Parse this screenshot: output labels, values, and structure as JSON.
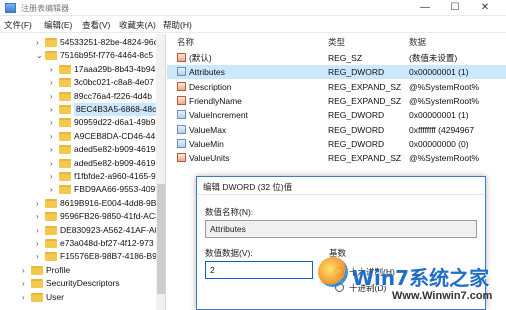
{
  "window": {
    "title": "注册表编辑器",
    "min_glyph": "—",
    "max_glyph": "☐",
    "close_glyph": "✕"
  },
  "menu": [
    "文件(F)",
    "编辑(E)",
    "查看(V)",
    "收藏夹(A)",
    "帮助(H)"
  ],
  "tree": {
    "items": [
      {
        "label": "54533251-82be-4824-96c",
        "expander": "›",
        "indent": 0
      },
      {
        "label": "7516b95f-f776-4464-8c5",
        "expander": "⌄",
        "indent": 0
      },
      {
        "label": "17aaa29b-8b43-4b94",
        "expander": "›",
        "indent": 1
      },
      {
        "label": "3c0bc021-c8a8-4e07",
        "expander": "›",
        "indent": 1
      },
      {
        "label": "89cc76a4-f226-4d4b",
        "expander": "›",
        "indent": 1
      },
      {
        "label": "8EC4B3A5-6868-48c2",
        "expander": "›",
        "indent": 1,
        "selected": true
      },
      {
        "label": "90959d22-d6a1-49b9",
        "expander": "›",
        "indent": 1
      },
      {
        "label": "A9CEB8DA-CD46-44F",
        "expander": "›",
        "indent": 1
      },
      {
        "label": "aded5e82-b909-4619",
        "expander": "›",
        "indent": 1
      },
      {
        "label": "aded5e82-b909-4619",
        "expander": "›",
        "indent": 1
      },
      {
        "label": "f1fbfde2-a960-4165-9",
        "expander": "›",
        "indent": 1
      },
      {
        "label": "FBD9AA66-9553-4097",
        "expander": "›",
        "indent": 1
      },
      {
        "label": "8619B916-E004-4dd8-9B",
        "expander": "›",
        "indent": 0
      },
      {
        "label": "9596FB26-9850-41fd-AC3",
        "expander": "›",
        "indent": 0
      },
      {
        "label": "DE830923-A562-41AF-A0",
        "expander": "›",
        "indent": 0
      },
      {
        "label": "e73a048d-bf27-4f12-973",
        "expander": "›",
        "indent": 0
      },
      {
        "label": "F15576E8-98B7-4186-B94",
        "expander": "›",
        "indent": 0
      },
      {
        "label": "Profile",
        "expander": "›",
        "indent": -1
      },
      {
        "label": "SecurityDescriptors",
        "expander": "›",
        "indent": -1
      },
      {
        "label": "User",
        "expander": "›",
        "indent": -1
      }
    ]
  },
  "list": {
    "headers": {
      "name": "名称",
      "type": "类型",
      "data": "数据"
    },
    "rows": [
      {
        "name": "(默认)",
        "type": "REG_SZ",
        "data": "(数值未设置)",
        "kind": "str"
      },
      {
        "name": "Attributes",
        "type": "REG_DWORD",
        "data": "0x00000001 (1)",
        "kind": "bin",
        "selected": true
      },
      {
        "name": "Description",
        "type": "REG_EXPAND_SZ",
        "data": "@%SystemRoot%",
        "kind": "str"
      },
      {
        "name": "FriendlyName",
        "type": "REG_EXPAND_SZ",
        "data": "@%SystemRoot%",
        "kind": "str"
      },
      {
        "name": "ValueIncrement",
        "type": "REG_DWORD",
        "data": "0x00000001 (1)",
        "kind": "bin"
      },
      {
        "name": "ValueMax",
        "type": "REG_DWORD",
        "data": "0xffffffff (4294967",
        "kind": "bin"
      },
      {
        "name": "ValueMin",
        "type": "REG_DWORD",
        "data": "0x00000000 (0)",
        "kind": "bin"
      },
      {
        "name": "ValueUnits",
        "type": "REG_EXPAND_SZ",
        "data": "@%SystemRoot%",
        "kind": "str"
      }
    ]
  },
  "dialog": {
    "title": "编辑 DWORD (32 位)值",
    "name_label": "数值名称(N):",
    "name_value": "Attributes",
    "data_label": "数值数据(V):",
    "data_value": "2",
    "base_label": "基数",
    "radio_hex": "十六进制(H)",
    "radio_dec": "十进制(D)"
  },
  "watermark": {
    "brand": "Win7系统之家",
    "url": "Www.Winwin7.com"
  }
}
